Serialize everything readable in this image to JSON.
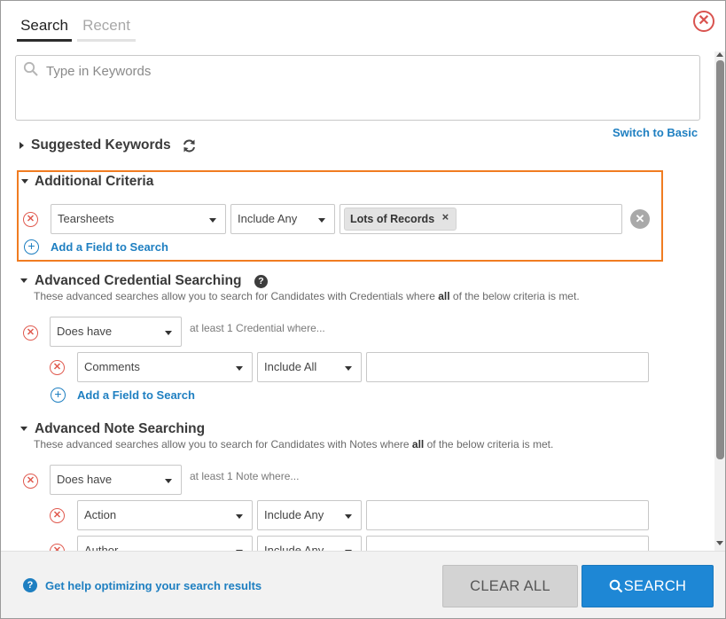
{
  "tabs": [
    {
      "label": "Search",
      "active": true
    },
    {
      "label": "Recent",
      "active": false
    }
  ],
  "keyword_search": {
    "placeholder": "Type in Keywords",
    "value": ""
  },
  "switch_link": "Switch to Basic",
  "suggested": {
    "title": "Suggested Keywords"
  },
  "additional": {
    "title": "Additional Criteria",
    "field": "Tearsheets",
    "operator": "Include Any",
    "chips": [
      "Lots of Records"
    ],
    "add_field": "Add a Field to Search"
  },
  "credential": {
    "title": "Advanced Credential Searching",
    "desc_pre": "These advanced searches allow you to search for Candidates with Credentials where ",
    "desc_bold": "all",
    "desc_post": " of the below criteria is met.",
    "has": "Does have",
    "at_least": "at least 1 Credential where...",
    "field": "Comments",
    "operator": "Include All",
    "add_field": "Add a Field to Search"
  },
  "note": {
    "title": "Advanced Note Searching",
    "desc_pre": "These advanced searches allow you to search for Candidates with Notes where ",
    "desc_bold": "all",
    "desc_post": " of the below criteria is met.",
    "has": "Does have",
    "at_least": "at least 1 Note where...",
    "rows": [
      {
        "field": "Action",
        "operator": "Include Any"
      },
      {
        "field": "Author",
        "operator": "Include Any"
      }
    ]
  },
  "footer": {
    "help_link": "Get help optimizing your search results",
    "clear_all": "CLEAR ALL",
    "search": "SEARCH"
  },
  "colors": {
    "accent_blue": "#1e87d5",
    "link_blue": "#1e7fc1",
    "highlight_orange": "#f07c21",
    "remove_red": "#e05a4f"
  }
}
